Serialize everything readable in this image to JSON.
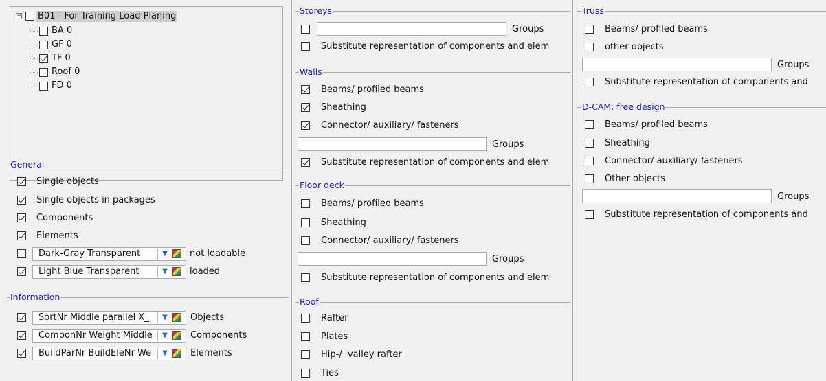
{
  "tree": {
    "root": {
      "label": "B01 - For Training Load Planing",
      "checked": false
    },
    "children": [
      {
        "label": "BA 0",
        "checked": false
      },
      {
        "label": "GF 0",
        "checked": false
      },
      {
        "label": "TF 0",
        "checked": true
      },
      {
        "label": "Roof 0",
        "checked": false
      },
      {
        "label": "FD 0",
        "checked": false
      }
    ]
  },
  "general": {
    "title": "General",
    "items": [
      {
        "label": "Single objects",
        "checked": true
      },
      {
        "label": "Single objects in packages",
        "checked": true
      },
      {
        "label": "Components",
        "checked": true
      },
      {
        "label": "Elements",
        "checked": true
      }
    ],
    "combos": [
      {
        "value": "Dark-Gray Transparent",
        "status": "not loadable",
        "checked": false
      },
      {
        "value": "Light Blue Transparent",
        "status": "loaded",
        "checked": true
      }
    ]
  },
  "information": {
    "title": "Information",
    "rows": [
      {
        "value": "SortNr Middle parallel X_",
        "label": "Objects",
        "checked": true
      },
      {
        "value": "ComponNr Weight Middle",
        "label": "Components",
        "checked": true
      },
      {
        "value": "BuildParNr BuildEleNr We",
        "label": "Elements",
        "checked": true
      }
    ]
  },
  "storeys": {
    "title": "Storeys",
    "groups_label": "Groups",
    "groups_checked": false,
    "groups_value": "",
    "substitute": {
      "label": "Substitute representation of components and elem",
      "checked": false
    }
  },
  "walls": {
    "title": "Walls",
    "items": [
      {
        "label": "Beams/ profiled beams",
        "checked": true
      },
      {
        "label": "Sheathing",
        "checked": true
      },
      {
        "label": "Connector/ auxiliary/ fasteners",
        "checked": true
      }
    ],
    "groups_label": "Groups",
    "groups_value": "",
    "substitute": {
      "label": "Substitute representation of components and elem",
      "checked": true
    }
  },
  "floor_deck": {
    "title": "Floor deck",
    "items": [
      {
        "label": "Beams/ profiled beams",
        "checked": false
      },
      {
        "label": "Sheathing",
        "checked": false
      },
      {
        "label": "Connector/ auxiliary/ fasteners",
        "checked": false
      }
    ],
    "groups_label": "Groups",
    "groups_value": "",
    "substitute": {
      "label": "Substitute representation of components and elem",
      "checked": false
    }
  },
  "roof": {
    "title": "Roof",
    "items": [
      {
        "label": "Rafter",
        "checked": false
      },
      {
        "label": "Plates",
        "checked": false
      },
      {
        "label": "Hip-/  valley rafter",
        "checked": false
      },
      {
        "label": "Ties",
        "checked": false
      }
    ]
  },
  "truss": {
    "title": "Truss",
    "items": [
      {
        "label": "Beams/ profiled beams",
        "checked": false
      },
      {
        "label": "other objects",
        "checked": false
      }
    ],
    "groups_label": "Groups",
    "groups_value": "",
    "substitute": {
      "label": "Substitute representation of components and",
      "checked": false
    }
  },
  "dcam": {
    "title": "D-CAM: free design",
    "items": [
      {
        "label": "Beams/ profiled beams",
        "checked": false
      },
      {
        "label": "Sheathing",
        "checked": false
      },
      {
        "label": "Connector/ auxiliary/ fasteners",
        "checked": false
      },
      {
        "label": "Other objects",
        "checked": false
      }
    ],
    "groups_label": "Groups",
    "groups_value": "",
    "substitute": {
      "label": "Substitute representation of components and",
      "checked": false
    }
  },
  "icons": {
    "dropdown": "dropdown-arrow-icon",
    "palette": "color-palette-icon",
    "tree_toggle": "collapse-icon"
  }
}
